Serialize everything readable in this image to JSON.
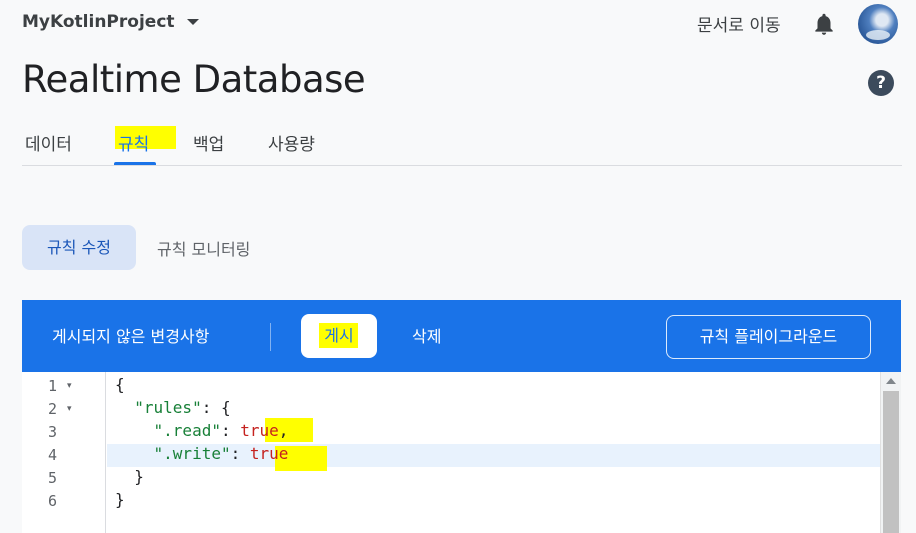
{
  "header": {
    "project_name": "MyKotlinProject",
    "docs_link": "문서로 이동",
    "page_title": "Realtime Database",
    "help_symbol": "?"
  },
  "tabs": [
    {
      "label": "데이터",
      "active": false
    },
    {
      "label": "규칙",
      "active": true
    },
    {
      "label": "백업",
      "active": false
    },
    {
      "label": "사용량",
      "active": false
    }
  ],
  "subnav": {
    "edit_rules": "규칙 수정",
    "monitor_rules": "규칙 모니터링"
  },
  "toolbar": {
    "unsaved_text": "게시되지 않은 변경사항",
    "publish_label": "게시",
    "discard_label": "삭제",
    "playground_label": "규칙 플레이그라운드"
  },
  "editor": {
    "line_numbers": [
      "1",
      "2",
      "3",
      "4",
      "5",
      "6"
    ],
    "fold_marker": "▾",
    "lines": [
      {
        "parts": [
          {
            "t": "{",
            "c": ""
          }
        ]
      },
      {
        "parts": [
          {
            "t": "  ",
            "c": ""
          },
          {
            "t": "\"rules\"",
            "c": "str"
          },
          {
            "t": ": {",
            "c": ""
          }
        ]
      },
      {
        "parts": [
          {
            "t": "    ",
            "c": ""
          },
          {
            "t": "\".read\"",
            "c": "str"
          },
          {
            "t": ": ",
            "c": ""
          },
          {
            "t": "true",
            "c": "kw"
          },
          {
            "t": ",",
            "c": ""
          }
        ]
      },
      {
        "parts": [
          {
            "t": "    ",
            "c": ""
          },
          {
            "t": "\".write\"",
            "c": "str"
          },
          {
            "t": ": ",
            "c": ""
          },
          {
            "t": "true",
            "c": "kw"
          }
        ]
      },
      {
        "parts": [
          {
            "t": "  }",
            "c": ""
          }
        ]
      },
      {
        "parts": [
          {
            "t": "}",
            "c": ""
          }
        ]
      }
    ]
  },
  "colors": {
    "accent": "#1a73e8",
    "highlight": "#ffff00",
    "string": "#188038",
    "keyword": "#c5221f"
  }
}
